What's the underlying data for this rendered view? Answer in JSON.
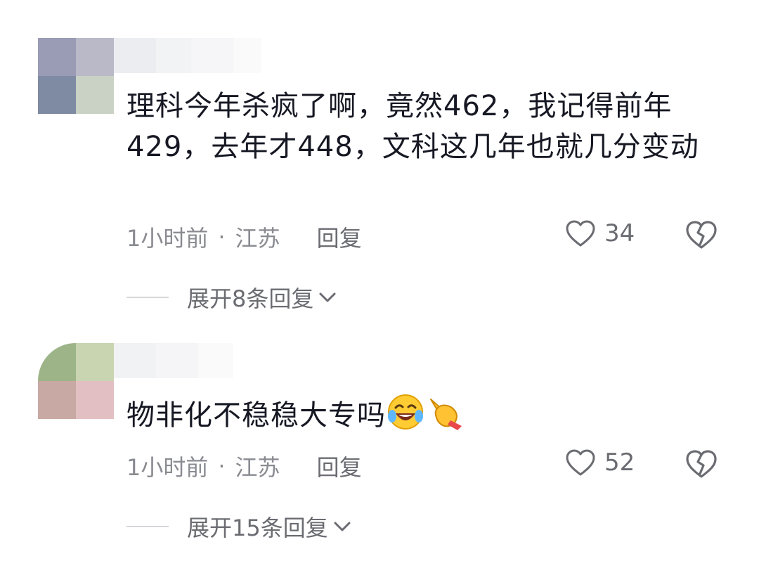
{
  "comments": [
    {
      "text": "理科今年杀疯了啊，竟然462，我记得前年429，去年才448，文科这几年也就几分变动",
      "time": "1小时前",
      "separator": "·",
      "location": "江苏",
      "reply_label": "回复",
      "likes": "34",
      "expand_label": "展开8条回复"
    },
    {
      "text": "物非化不稳稳大专吗",
      "time": "1小时前",
      "separator": "·",
      "location": "江苏",
      "reply_label": "回复",
      "likes": "52",
      "expand_label": "展开15条回复",
      "emojis": [
        "rofl-emoji",
        "pointing-hand-emoji"
      ]
    }
  ],
  "icons": {
    "like": "heart-outline-icon",
    "dislike": "broken-heart-icon",
    "expand": "chevron-down-icon"
  },
  "colors": {
    "text": "#161823",
    "meta": "#8a8b91",
    "icon": "#6b6c72"
  }
}
